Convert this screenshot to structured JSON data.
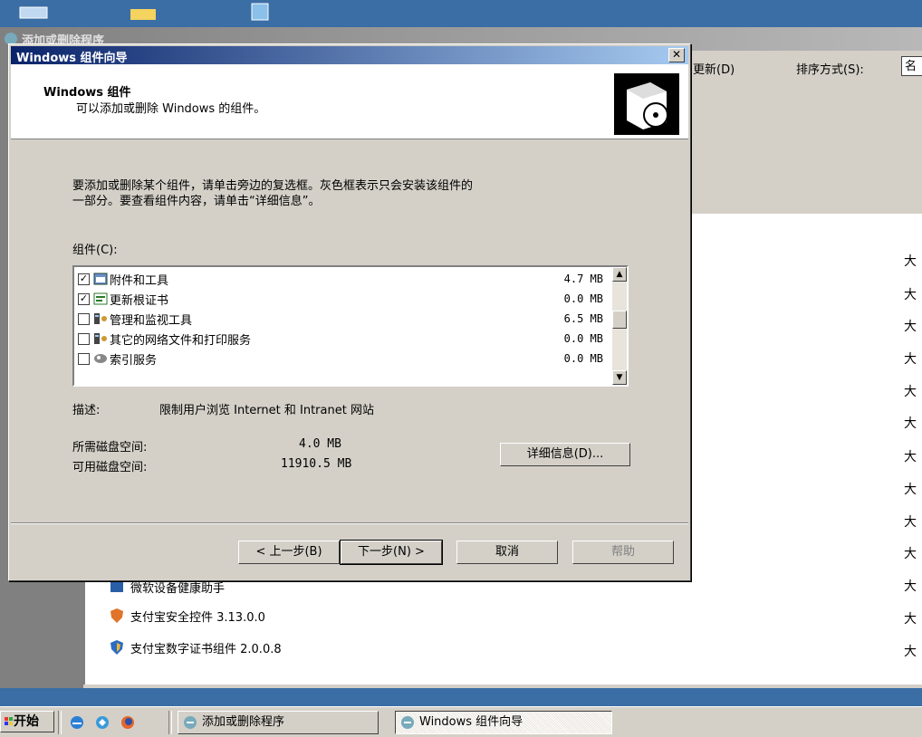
{
  "background_window": {
    "title": "添加或删除程序",
    "update_label": "更新(D)",
    "sort_label": "排序方式(S):",
    "sort_value": "名",
    "list_rows": [
      {
        "name": "微软设备健康助手"
      },
      {
        "name": "支付宝安全控件 3.13.0.0"
      },
      {
        "name": "支付宝数字证书组件 2.0.0.8"
      }
    ],
    "size_column": [
      "大",
      "大",
      "大",
      "大",
      "大",
      "大",
      "大",
      "大",
      "大",
      "大",
      "大",
      "大",
      "大"
    ]
  },
  "wizard": {
    "title": "Windows 组件向导",
    "close_label": "✕",
    "header_title": "Windows 组件",
    "header_subtitle": "可以添加或删除 Windows 的组件。",
    "intro_line1": "要添加或删除某个组件，请单击旁边的复选框。灰色框表示只会安装该组件的",
    "intro_line2": "一部分。要查看组件内容，请单击“详细信息”。",
    "components_label": "组件(C):",
    "components": [
      {
        "name": "附件和工具",
        "size": "4.7 MB",
        "checked": true,
        "icon": "accessories-icon"
      },
      {
        "name": "更新根证书",
        "size": "0.0 MB",
        "checked": true,
        "icon": "certificate-icon"
      },
      {
        "name": "管理和监视工具",
        "size": "6.5 MB",
        "checked": false,
        "icon": "management-icon"
      },
      {
        "name": "其它的网络文件和打印服务",
        "size": "0.0 MB",
        "checked": false,
        "icon": "network-icon"
      },
      {
        "name": "索引服务",
        "size": "0.0 MB",
        "checked": false,
        "icon": "index-icon"
      }
    ],
    "description_label": "描述:",
    "description_value": "限制用户浏览 Internet 和 Intranet 网站",
    "disk_required_label": "所需磁盘空间:",
    "disk_required_value": "4.0 MB",
    "disk_available_label": "可用磁盘空间:",
    "disk_available_value": "11910.5 MB",
    "details_button": "详细信息(D)...",
    "back_button": "< 上一步(B)",
    "next_button": "下一步(N) >",
    "cancel_button": "取消",
    "help_button": "帮助"
  },
  "taskbar": {
    "start_label": "开始",
    "tasks": [
      {
        "label": "添加或删除程序"
      },
      {
        "label": "Windows 组件向导"
      }
    ]
  },
  "colors": {
    "desktop": "#3a6ea5",
    "titlebar_active": "#0a246a",
    "face": "#d4d0c8"
  }
}
